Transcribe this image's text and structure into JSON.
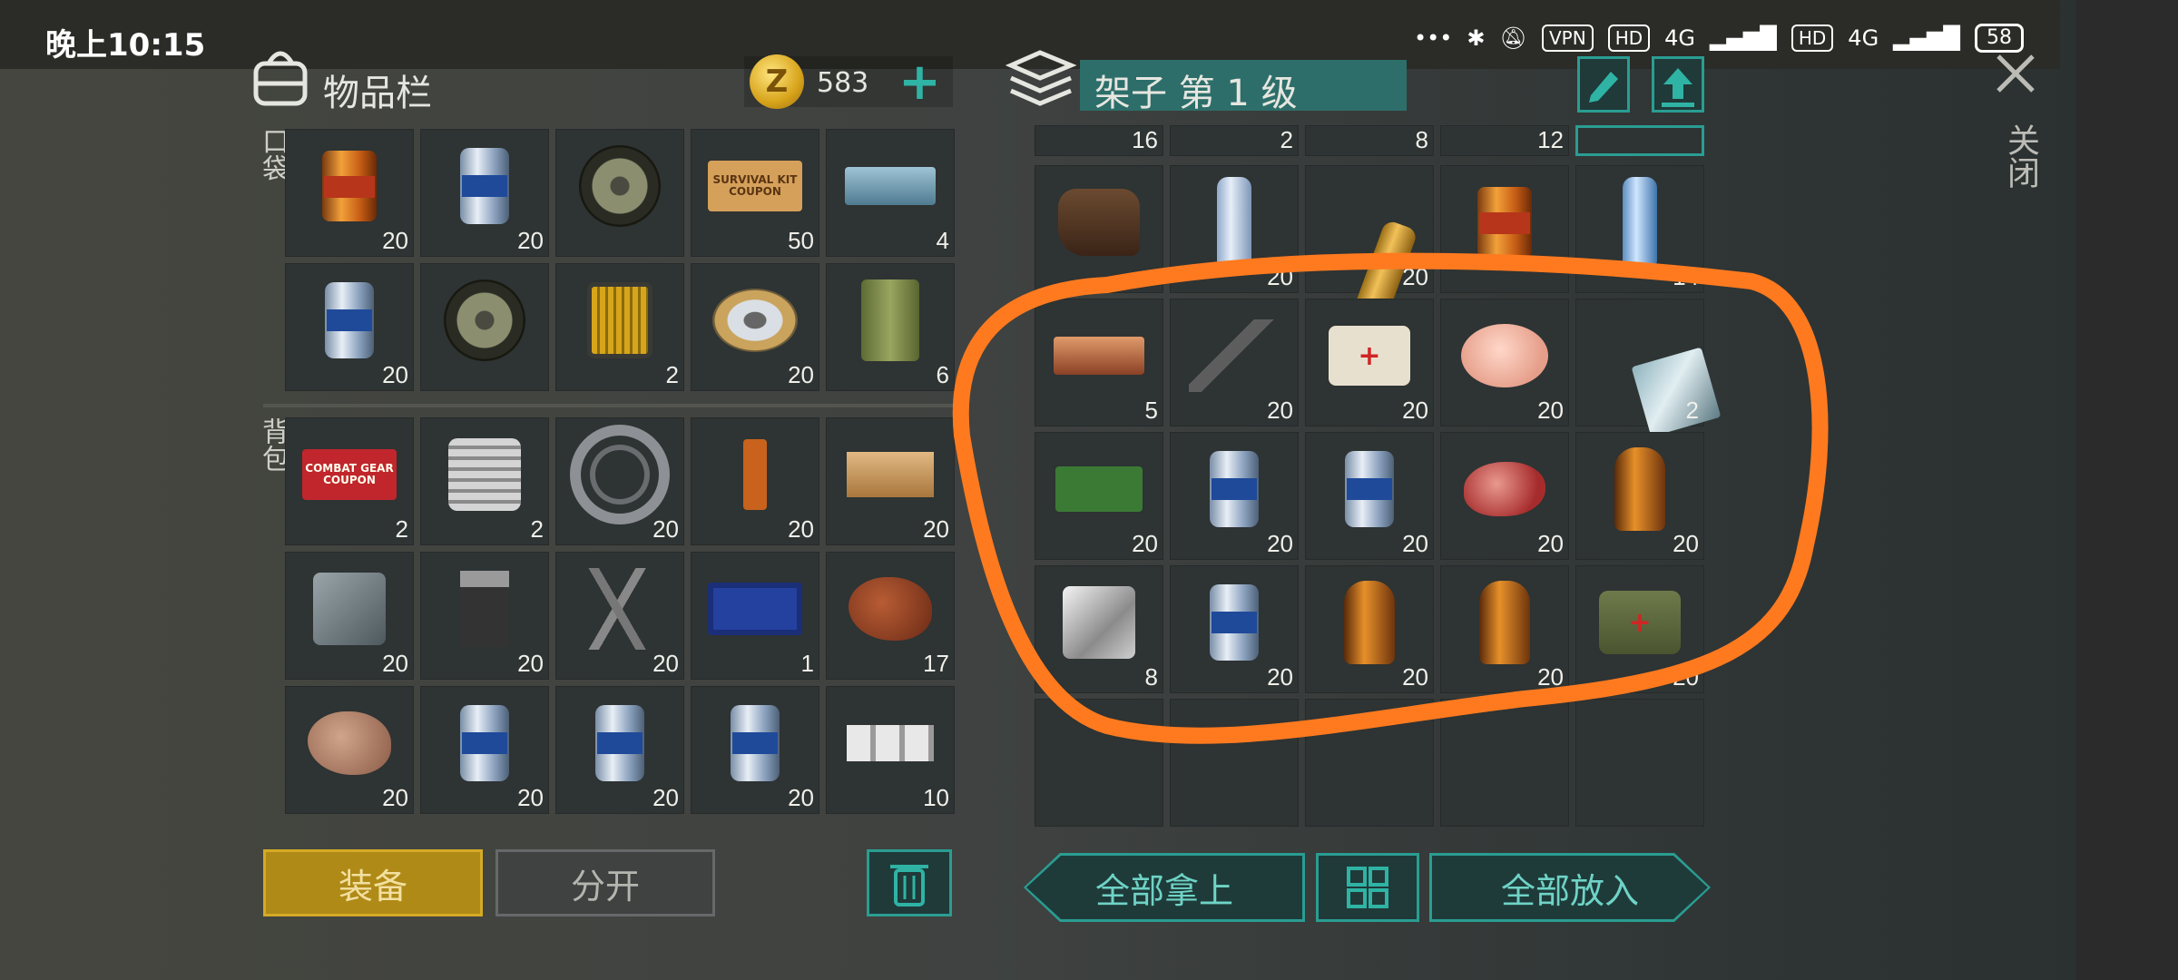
{
  "status_bar": {
    "time": "晚上10:15",
    "icons": [
      "•••",
      "bluetooth-icon",
      "bell-off-icon"
    ],
    "vpn": "VPN",
    "hd1": "HD",
    "net1": "4G",
    "hd2": "HD",
    "net2": "4G",
    "battery": "58"
  },
  "inventory": {
    "title": "物品栏",
    "coins": "583",
    "coin_symbol": "Z",
    "pocket_label": "口袋",
    "backpack_label": "背包",
    "pocket_items": [
      {
        "icon": "food-can",
        "count": "20"
      },
      {
        "icon": "beer-can",
        "count": "20"
      },
      {
        "icon": "wheel",
        "count": ""
      },
      {
        "icon": "survival-kit-coupon",
        "count": "50",
        "text": "SURVIVAL KIT COUPON"
      },
      {
        "icon": "metal-ingot",
        "count": "4"
      },
      {
        "icon": "beer-can",
        "count": "20"
      },
      {
        "icon": "wheel",
        "count": ""
      },
      {
        "icon": "oil-filter",
        "count": "2"
      },
      {
        "icon": "wire-spool",
        "count": "20"
      },
      {
        "icon": "jerry-can",
        "count": "6"
      }
    ],
    "backpack_items": [
      {
        "icon": "combat-gear-coupon",
        "count": "2",
        "text": "COMBAT GEAR COUPON"
      },
      {
        "icon": "engine-cylinder",
        "count": "2"
      },
      {
        "icon": "bearing",
        "count": "20"
      },
      {
        "icon": "usb-stick",
        "count": "20"
      },
      {
        "icon": "wood-plank",
        "count": "20"
      },
      {
        "icon": "metal-sheet",
        "count": "20"
      },
      {
        "icon": "transistor",
        "count": "20"
      },
      {
        "icon": "nails",
        "count": "20"
      },
      {
        "icon": "circuit-board",
        "count": "1"
      },
      {
        "icon": "copper-ore",
        "count": "17"
      },
      {
        "icon": "stone",
        "count": "20"
      },
      {
        "icon": "beer-can",
        "count": "20"
      },
      {
        "icon": "beer-can",
        "count": "20"
      },
      {
        "icon": "beer-can",
        "count": "20"
      },
      {
        "icon": "silver-bars",
        "count": "10"
      }
    ],
    "buttons": {
      "equip": "装备",
      "split": "分开"
    }
  },
  "shelf": {
    "title": "架子 第 1 级",
    "close_label": "关闭",
    "partial_row_counts": [
      "16",
      "2",
      "8",
      "12",
      ""
    ],
    "items": [
      {
        "icon": "boots",
        "count": ""
      },
      {
        "icon": "plastic-bottle",
        "count": "20"
      },
      {
        "icon": "orange-bottle",
        "count": "20"
      },
      {
        "icon": "food-can",
        "count": ""
      },
      {
        "icon": "water-bottle",
        "count": "14"
      },
      {
        "icon": "copper-ingot",
        "count": "5"
      },
      {
        "icon": "tool-parts",
        "count": "20"
      },
      {
        "icon": "bandage",
        "count": "20"
      },
      {
        "icon": "raw-chicken",
        "count": "20"
      },
      {
        "icon": "glass-sheet",
        "count": "2"
      },
      {
        "icon": "camera-module",
        "count": "20"
      },
      {
        "icon": "beer-can",
        "count": "20"
      },
      {
        "icon": "beer-can",
        "count": "20"
      },
      {
        "icon": "raw-steak",
        "count": "20"
      },
      {
        "icon": "whiskey-bottle",
        "count": "20"
      },
      {
        "icon": "aluminum-sheet",
        "count": "8"
      },
      {
        "icon": "beer-can",
        "count": "20"
      },
      {
        "icon": "whiskey-bottle",
        "count": "20"
      },
      {
        "icon": "whiskey-bottle",
        "count": "20"
      },
      {
        "icon": "medical-bag",
        "count": "20"
      },
      {
        "icon": "empty",
        "count": ""
      },
      {
        "icon": "empty",
        "count": ""
      },
      {
        "icon": "empty",
        "count": ""
      },
      {
        "icon": "empty",
        "count": ""
      },
      {
        "icon": "empty",
        "count": ""
      }
    ],
    "buttons": {
      "take_all": "全部拿上",
      "put_all": "全部放入"
    }
  },
  "colors": {
    "accent_teal": "#2a9d92",
    "equip_gold": "#b08a17",
    "annotation_orange": "#ff7a1f"
  }
}
